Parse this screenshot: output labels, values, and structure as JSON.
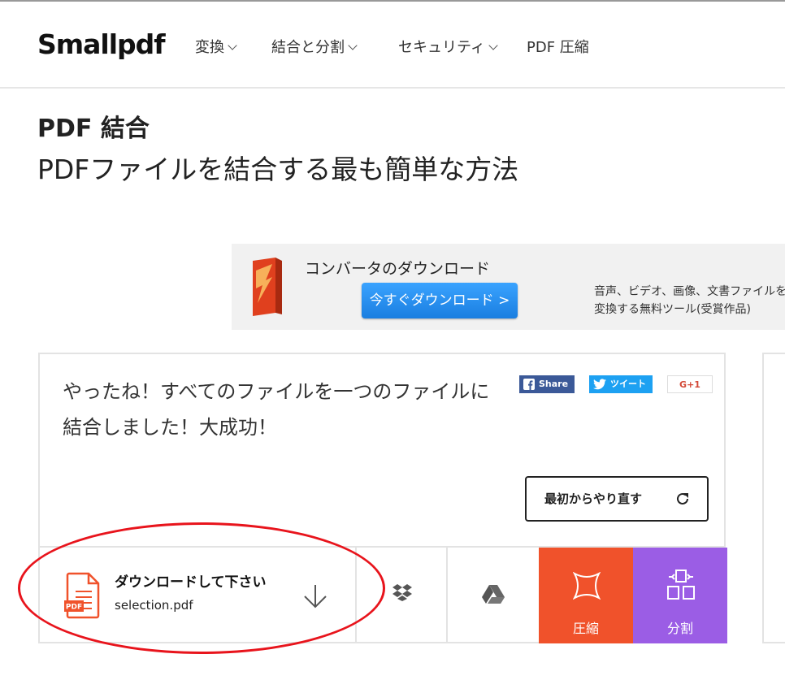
{
  "nav": {
    "logo": "Smallpdf",
    "items": [
      {
        "label": "変換",
        "dropdown": true
      },
      {
        "label": "結合と分割",
        "dropdown": true
      },
      {
        "label": "セキュリティ",
        "dropdown": true
      },
      {
        "label": "PDF 圧縮",
        "dropdown": false
      }
    ]
  },
  "page": {
    "title": "PDF 結合",
    "subtitle": "PDFファイルを結合する最も簡単な方法"
  },
  "ad": {
    "title": "コンバータのダウンロード",
    "button": "今すぐダウンロード >",
    "desc_line1": "音声、ビデオ、画像、文書ファイルを",
    "desc_line2": "変換する無料ツール(受賞作品)"
  },
  "result": {
    "message": "やったね！すべてのファイルを一つのファイルに結合しました！大成功！",
    "share": {
      "facebook": "Share",
      "twitter": "ツイート",
      "google": "G+1"
    },
    "restart": "最初からやり直す",
    "download_label": "ダウンロードして下さい",
    "filename": "selection.pdf",
    "file_badge": "PDF",
    "tools": {
      "compress": "圧縮",
      "split": "分割"
    }
  },
  "colors": {
    "compress": "#f0522b",
    "split": "#9b5de5",
    "annotation": "#e8141c"
  },
  "icons": [
    "chevron-down-icon",
    "box-icon",
    "facebook-icon",
    "twitter-icon",
    "refresh-icon",
    "pdf-file-icon",
    "download-arrow-icon",
    "dropbox-icon",
    "google-drive-icon",
    "compress-icon",
    "split-icon"
  ]
}
